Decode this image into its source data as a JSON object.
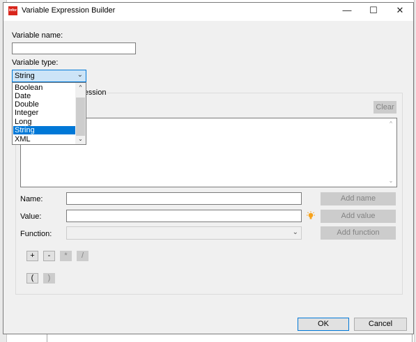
{
  "window": {
    "title": "Variable Expression Builder",
    "app_icon_text": "infor",
    "minimize": "—",
    "maximize": "☐",
    "close": "✕"
  },
  "form": {
    "variable_name_label": "Variable name:",
    "variable_name_value": "",
    "variable_type_label": "Variable type:",
    "variable_type_value": "String",
    "type_options": [
      "Boolean",
      "Date",
      "Double",
      "Integer",
      "Long",
      "String",
      "XML"
    ],
    "selected_option": "String"
  },
  "expression": {
    "group_label_fragment": "ression",
    "clear_label": "Clear",
    "editor_text": ""
  },
  "builder": {
    "name_label": "Name:",
    "name_value": "",
    "value_label": "Value:",
    "value_value": "",
    "function_label": "Function:",
    "function_value": "",
    "add_name_label": "Add name",
    "add_value_label": "Add value",
    "add_function_label": "Add function"
  },
  "operators": {
    "plus": "+",
    "minus": "-",
    "multiply": "*",
    "divide": "/",
    "open_paren": "(",
    "close_paren": ")"
  },
  "footer": {
    "ok_label": "OK",
    "cancel_label": "Cancel"
  },
  "colors": {
    "accent": "#0078d7",
    "selected_bg": "#cce4f7",
    "disabled_button": "#cccccc",
    "app_icon": "#d9261c",
    "bulb": "#f7a21b"
  }
}
